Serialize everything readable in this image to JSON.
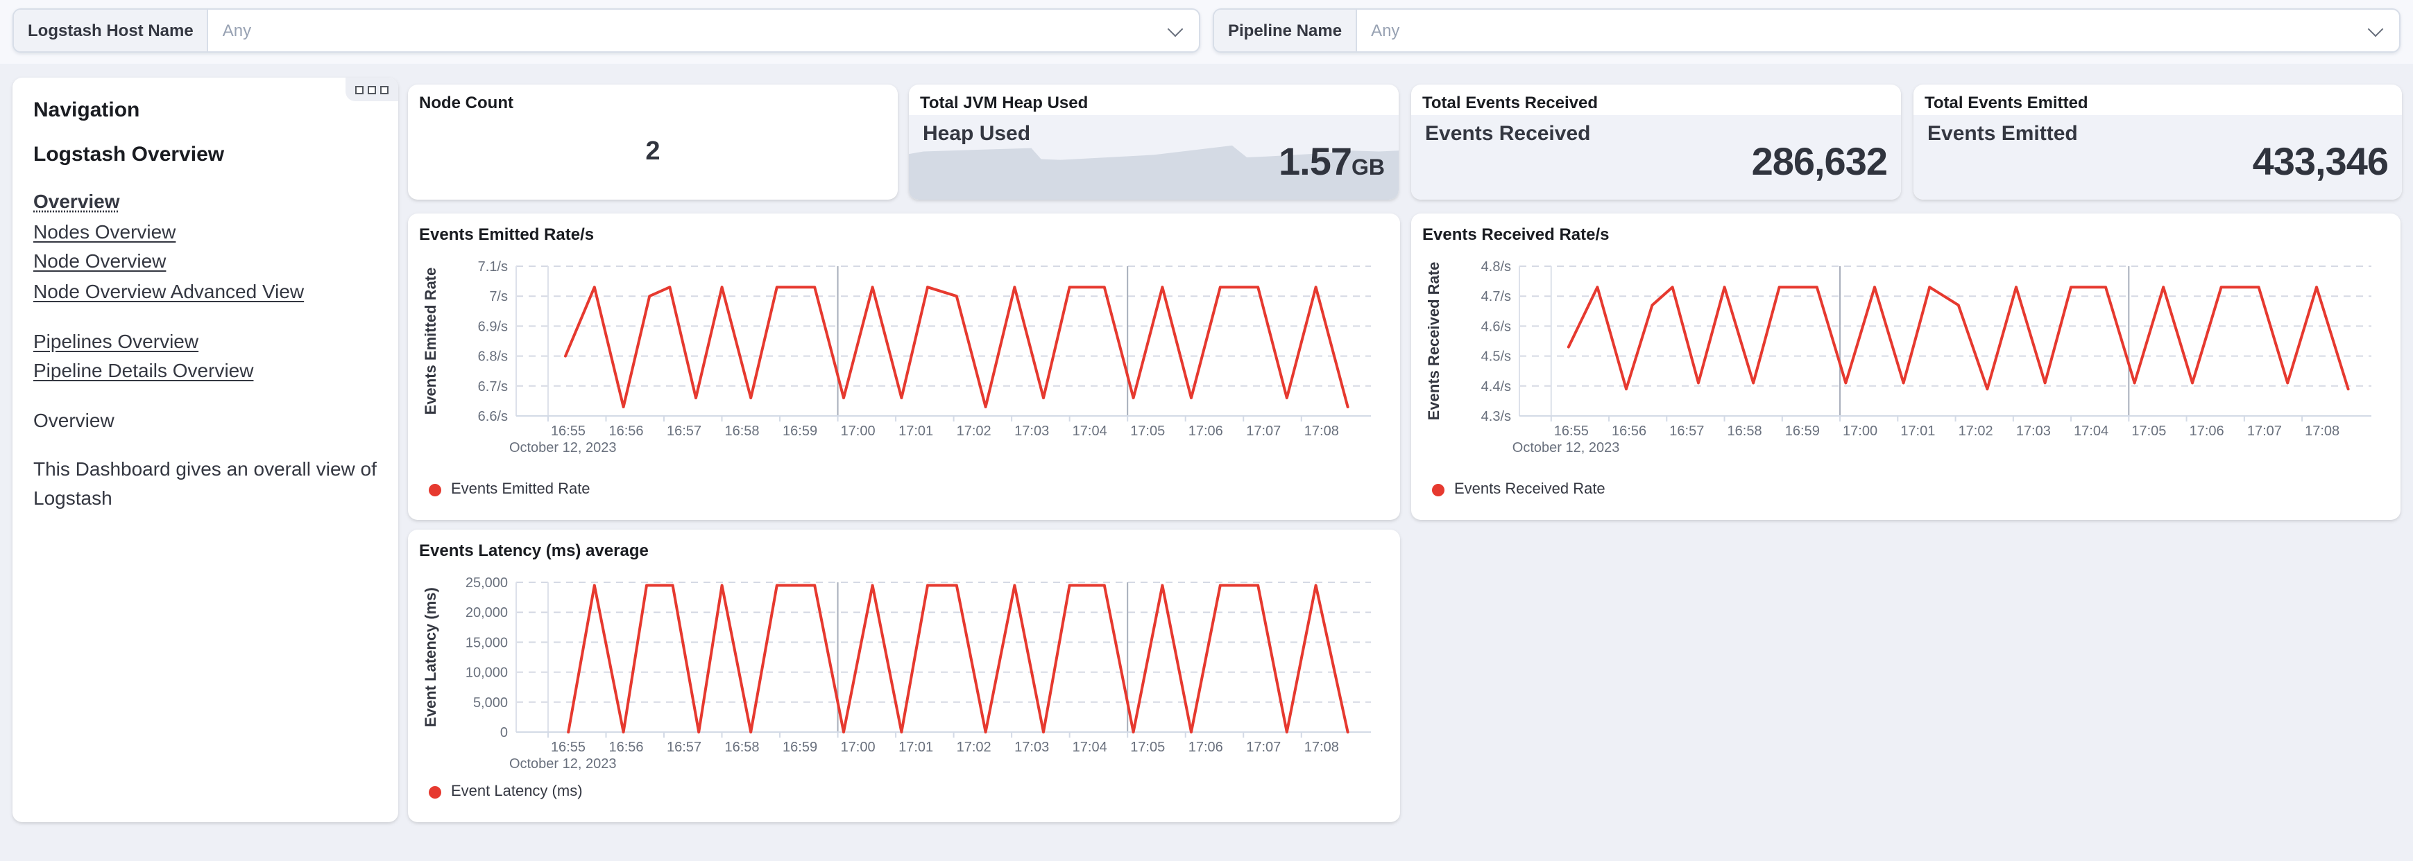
{
  "filters": {
    "host": {
      "label": "Logstash Host Name",
      "value": "Any"
    },
    "pipeline": {
      "label": "Pipeline Name",
      "value": "Any"
    }
  },
  "navigation": {
    "title": "Navigation",
    "section_title": "Logstash Overview",
    "links_group1": [
      {
        "label": "Overview",
        "current": true
      },
      {
        "label": "Nodes Overview",
        "current": false
      },
      {
        "label": "Node Overview",
        "current": false
      },
      {
        "label": "Node Overview Advanced View",
        "current": false
      }
    ],
    "links_group2": [
      {
        "label": "Pipelines Overview",
        "current": false
      },
      {
        "label": "Pipeline Details Overview",
        "current": false
      }
    ],
    "subheading": "Overview",
    "description": "This Dashboard gives an overall view of Logstash"
  },
  "metrics": {
    "node_count": {
      "panel_title": "Node Count",
      "value": "2"
    },
    "jvm_heap": {
      "panel_title": "Total JVM Heap Used",
      "label": "Heap Used",
      "value": "1.57",
      "unit": "GB",
      "spark_points": [
        [
          0,
          54
        ],
        [
          3,
          57
        ],
        [
          25,
          61
        ],
        [
          27,
          48
        ],
        [
          31,
          47
        ],
        [
          50,
          53
        ],
        [
          66,
          64
        ],
        [
          69,
          50
        ],
        [
          73,
          51
        ],
        [
          88,
          56
        ],
        [
          90,
          58
        ],
        [
          96,
          57
        ],
        [
          100,
          58
        ]
      ]
    },
    "events_received": {
      "panel_title": "Total Events Received",
      "label": "Events Received",
      "value": "286,632"
    },
    "events_emitted": {
      "panel_title": "Total Events Emitted",
      "label": "Events Emitted",
      "value": "433,346"
    }
  },
  "colors": {
    "line_red": "#e6392f",
    "area_gray": "#d4dae4",
    "grid_dashed": "#d5d9e4",
    "vline_light": "#dde1ea",
    "vline_dark": "#a7aebb",
    "axis_line": "#d3dae6",
    "tick_text": "#69707d",
    "axis_title_text": "#343741"
  },
  "chart_data": [
    {
      "id": "events_emitted_rate",
      "type": "line",
      "title": "Events Emitted Rate/s",
      "ylabel": "Events Emitted Rate",
      "legend": "Events Emitted Rate",
      "ylim": [
        6.6,
        7.1
      ],
      "y_ticks": [
        {
          "v": 7.1,
          "label": "7.1/s"
        },
        {
          "v": 7.0,
          "label": "7/s"
        },
        {
          "v": 6.9,
          "label": "6.9/s"
        },
        {
          "v": 6.8,
          "label": "6.8/s"
        },
        {
          "v": 6.7,
          "label": "6.7/s"
        },
        {
          "v": 6.6,
          "label": "6.6/s"
        }
      ],
      "xlim": [
        0.45,
        15.2
      ],
      "x_ticks": [
        {
          "m": 1,
          "label": "16:55"
        },
        {
          "m": 2,
          "label": "16:56"
        },
        {
          "m": 3,
          "label": "16:57"
        },
        {
          "m": 4,
          "label": "16:58"
        },
        {
          "m": 5,
          "label": "16:59"
        },
        {
          "m": 6,
          "label": "17:00"
        },
        {
          "m": 7,
          "label": "17:01"
        },
        {
          "m": 8,
          "label": "17:02"
        },
        {
          "m": 9,
          "label": "17:03"
        },
        {
          "m": 10,
          "label": "17:04"
        },
        {
          "m": 11,
          "label": "17:05"
        },
        {
          "m": 12,
          "label": "17:06"
        },
        {
          "m": 13,
          "label": "17:07"
        },
        {
          "m": 14,
          "label": "17:08"
        }
      ],
      "grid_vlines": [
        {
          "m": 1,
          "shade": "light"
        },
        {
          "m": 6,
          "shade": "dark"
        },
        {
          "m": 11,
          "shade": "dark"
        }
      ],
      "x_date_label": "October 12, 2023",
      "points": [
        [
          1.3,
          6.8
        ],
        [
          1.8,
          7.03
        ],
        [
          2.3,
          6.63
        ],
        [
          2.75,
          7.0
        ],
        [
          3.1,
          7.03
        ],
        [
          3.55,
          6.66
        ],
        [
          4.0,
          7.03
        ],
        [
          4.5,
          6.66
        ],
        [
          4.95,
          7.03
        ],
        [
          5.6,
          7.03
        ],
        [
          6.1,
          6.66
        ],
        [
          6.6,
          7.03
        ],
        [
          7.1,
          6.66
        ],
        [
          7.55,
          7.03
        ],
        [
          8.05,
          7.0
        ],
        [
          8.55,
          6.63
        ],
        [
          9.05,
          7.03
        ],
        [
          9.55,
          6.66
        ],
        [
          10.0,
          7.03
        ],
        [
          10.6,
          7.03
        ],
        [
          11.1,
          6.66
        ],
        [
          11.6,
          7.03
        ],
        [
          12.1,
          6.66
        ],
        [
          12.6,
          7.03
        ],
        [
          13.25,
          7.03
        ],
        [
          13.75,
          6.66
        ],
        [
          14.25,
          7.03
        ],
        [
          14.8,
          6.63
        ]
      ]
    },
    {
      "id": "events_received_rate",
      "type": "line",
      "title": "Events Received Rate/s",
      "ylabel": "Events Received Rate",
      "legend": "Events Received Rate",
      "ylim": [
        4.3,
        4.8
      ],
      "y_ticks": [
        {
          "v": 4.8,
          "label": "4.8/s"
        },
        {
          "v": 4.7,
          "label": "4.7/s"
        },
        {
          "v": 4.6,
          "label": "4.6/s"
        },
        {
          "v": 4.5,
          "label": "4.5/s"
        },
        {
          "v": 4.4,
          "label": "4.4/s"
        },
        {
          "v": 4.3,
          "label": "4.3/s"
        }
      ],
      "xlim": [
        0.45,
        15.2
      ],
      "x_ticks": [
        {
          "m": 1,
          "label": "16:55"
        },
        {
          "m": 2,
          "label": "16:56"
        },
        {
          "m": 3,
          "label": "16:57"
        },
        {
          "m": 4,
          "label": "16:58"
        },
        {
          "m": 5,
          "label": "16:59"
        },
        {
          "m": 6,
          "label": "17:00"
        },
        {
          "m": 7,
          "label": "17:01"
        },
        {
          "m": 8,
          "label": "17:02"
        },
        {
          "m": 9,
          "label": "17:03"
        },
        {
          "m": 10,
          "label": "17:04"
        },
        {
          "m": 11,
          "label": "17:05"
        },
        {
          "m": 12,
          "label": "17:06"
        },
        {
          "m": 13,
          "label": "17:07"
        },
        {
          "m": 14,
          "label": "17:08"
        }
      ],
      "grid_vlines": [
        {
          "m": 1,
          "shade": "light"
        },
        {
          "m": 6,
          "shade": "dark"
        },
        {
          "m": 11,
          "shade": "dark"
        }
      ],
      "x_date_label": "October 12, 2023",
      "points": [
        [
          1.3,
          4.53
        ],
        [
          1.8,
          4.73
        ],
        [
          2.3,
          4.39
        ],
        [
          2.75,
          4.67
        ],
        [
          3.1,
          4.73
        ],
        [
          3.55,
          4.41
        ],
        [
          4.0,
          4.73
        ],
        [
          4.5,
          4.41
        ],
        [
          4.95,
          4.73
        ],
        [
          5.6,
          4.73
        ],
        [
          6.1,
          4.41
        ],
        [
          6.6,
          4.73
        ],
        [
          7.1,
          4.41
        ],
        [
          7.55,
          4.73
        ],
        [
          8.05,
          4.67
        ],
        [
          8.55,
          4.39
        ],
        [
          9.05,
          4.73
        ],
        [
          9.55,
          4.41
        ],
        [
          10.0,
          4.73
        ],
        [
          10.6,
          4.73
        ],
        [
          11.1,
          4.41
        ],
        [
          11.6,
          4.73
        ],
        [
          12.1,
          4.41
        ],
        [
          12.6,
          4.73
        ],
        [
          13.25,
          4.73
        ],
        [
          13.75,
          4.41
        ],
        [
          14.25,
          4.73
        ],
        [
          14.8,
          4.39
        ]
      ]
    },
    {
      "id": "event_latency",
      "type": "line",
      "title": "Events Latency (ms) average",
      "ylabel": "Event Latency (ms)",
      "legend": "Event Latency (ms)",
      "ylim": [
        0,
        25000
      ],
      "y_ticks": [
        {
          "v": 25000,
          "label": "25,000"
        },
        {
          "v": 20000,
          "label": "20,000"
        },
        {
          "v": 15000,
          "label": "15,000"
        },
        {
          "v": 10000,
          "label": "10,000"
        },
        {
          "v": 5000,
          "label": "5,000"
        },
        {
          "v": 0,
          "label": "0"
        }
      ],
      "xlim": [
        0.45,
        15.2
      ],
      "x_ticks": [
        {
          "m": 1,
          "label": "16:55"
        },
        {
          "m": 2,
          "label": "16:56"
        },
        {
          "m": 3,
          "label": "16:57"
        },
        {
          "m": 4,
          "label": "16:58"
        },
        {
          "m": 5,
          "label": "16:59"
        },
        {
          "m": 6,
          "label": "17:00"
        },
        {
          "m": 7,
          "label": "17:01"
        },
        {
          "m": 8,
          "label": "17:02"
        },
        {
          "m": 9,
          "label": "17:03"
        },
        {
          "m": 10,
          "label": "17:04"
        },
        {
          "m": 11,
          "label": "17:05"
        },
        {
          "m": 12,
          "label": "17:06"
        },
        {
          "m": 13,
          "label": "17:07"
        },
        {
          "m": 14,
          "label": "17:08"
        }
      ],
      "grid_vlines": [
        {
          "m": 1,
          "shade": "light"
        },
        {
          "m": 6,
          "shade": "dark"
        },
        {
          "m": 11,
          "shade": "dark"
        }
      ],
      "x_date_label": "October 12, 2023",
      "points": [
        [
          1.35,
          0
        ],
        [
          1.8,
          24500
        ],
        [
          2.3,
          0
        ],
        [
          2.7,
          24500
        ],
        [
          3.15,
          24500
        ],
        [
          3.6,
          0
        ],
        [
          4.0,
          24500
        ],
        [
          4.5,
          0
        ],
        [
          4.95,
          24500
        ],
        [
          5.6,
          24500
        ],
        [
          6.1,
          0
        ],
        [
          6.6,
          24500
        ],
        [
          7.1,
          0
        ],
        [
          7.55,
          24500
        ],
        [
          8.05,
          24500
        ],
        [
          8.55,
          0
        ],
        [
          9.05,
          24500
        ],
        [
          9.55,
          0
        ],
        [
          10.0,
          24500
        ],
        [
          10.6,
          24500
        ],
        [
          11.1,
          0
        ],
        [
          11.6,
          24500
        ],
        [
          12.1,
          0
        ],
        [
          12.6,
          24500
        ],
        [
          13.25,
          24500
        ],
        [
          13.75,
          0
        ],
        [
          14.25,
          24500
        ],
        [
          14.8,
          0
        ]
      ]
    }
  ]
}
